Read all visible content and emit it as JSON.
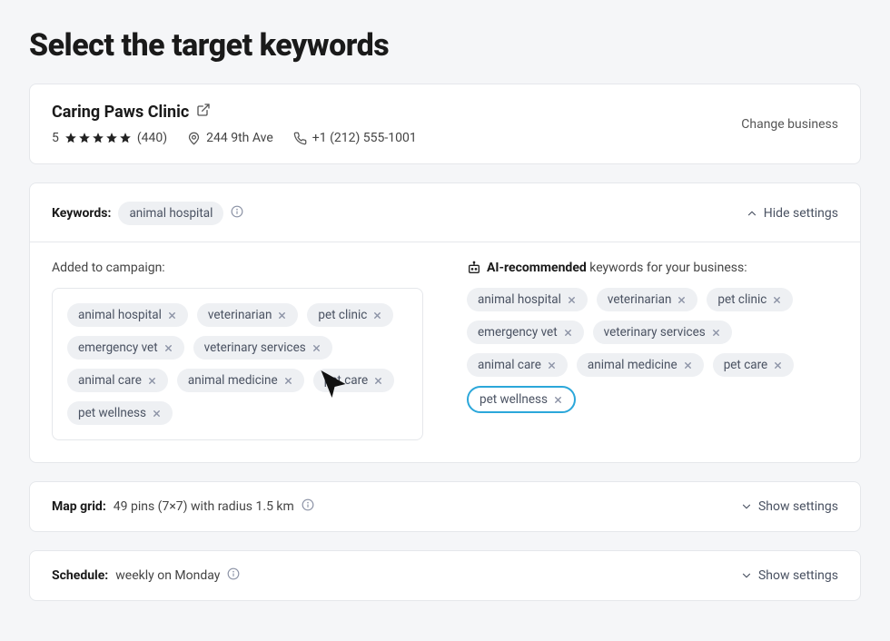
{
  "page": {
    "title": "Select the target keywords"
  },
  "business": {
    "name": "Caring Paws Clinic",
    "rating_value": "5",
    "review_count": "(440)",
    "address": "244 9th Ave",
    "phone": "+1 (212) 555-1001",
    "change_label": "Change business"
  },
  "keywords_section": {
    "label": "Keywords:",
    "selected_chip": "animal hospital",
    "toggle_label": "Hide settings",
    "added_title": "Added to campaign:",
    "ai_title_prefix": "AI-recommended",
    "ai_title_suffix": " keywords for your business:",
    "added": [
      "animal hospital",
      "veterinarian",
      "pet clinic",
      "emergency vet",
      "veterinary services",
      "animal care",
      "animal medicine",
      "pet care",
      "pet wellness"
    ],
    "ai": [
      "animal hospital",
      "veterinarian",
      "pet clinic",
      "emergency vet",
      "veterinary services",
      "animal care",
      "animal medicine",
      "pet care",
      "pet wellness"
    ],
    "ai_highlight_index": 8
  },
  "map_grid": {
    "label": "Map grid:",
    "value": "49 pins (7×7) with radius 1.5 km",
    "toggle_label": "Show settings"
  },
  "schedule": {
    "label": "Schedule:",
    "value": "weekly on Monday",
    "toggle_label": "Show settings"
  }
}
